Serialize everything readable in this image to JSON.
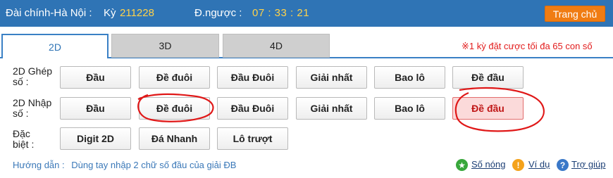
{
  "header": {
    "station": "Đài chính-Hà Nội  :",
    "ky_label": "Kỳ",
    "ky_value": "211228",
    "countdown_label": "Đ.ngược :",
    "countdown_value": "07 : 33 : 21",
    "home_button": "Trang chủ"
  },
  "tabs": [
    {
      "label": "2D",
      "active": true
    },
    {
      "label": "3D",
      "active": false
    },
    {
      "label": "4D",
      "active": false
    }
  ],
  "limit_note": "※1 kỳ đặt cược tối đa 65 con số",
  "rows": [
    {
      "label_line1": "2D Ghép",
      "label_line2": "số :",
      "buttons": [
        "Đầu",
        "Đề đuôi",
        "Đầu Đuôi",
        "Giải nhất",
        "Bao lô",
        "Đề đầu"
      ]
    },
    {
      "label_line1": "2D Nhập",
      "label_line2": "số :",
      "buttons": [
        "Đầu",
        "Đề đuôi",
        "Đầu Đuôi",
        "Giải nhất",
        "Bao lô",
        "Đề đầu"
      ],
      "selected": "Đề đầu"
    },
    {
      "label_line1": "Đặc",
      "label_line2": "biệt :",
      "buttons": [
        "Digit 2D",
        "Đá Nhanh",
        "Lô trượt"
      ]
    }
  ],
  "guide": {
    "label": "Hướng dẫn :",
    "text": "Dùng tay nhập 2 chữ số đầu của giải ĐB"
  },
  "links": {
    "hot": "Số nóng",
    "example": "Ví dụ",
    "help": "Trợ giúp"
  },
  "icons": {
    "hot": "star-icon",
    "example": "exclamation-icon",
    "help": "question-icon"
  },
  "colors": {
    "header_bg": "#2f74b5",
    "highlight_text": "#ffd24a",
    "home_button": "#f07c12",
    "note_red": "#e21c1c",
    "selected_bg": "#fbdada"
  }
}
